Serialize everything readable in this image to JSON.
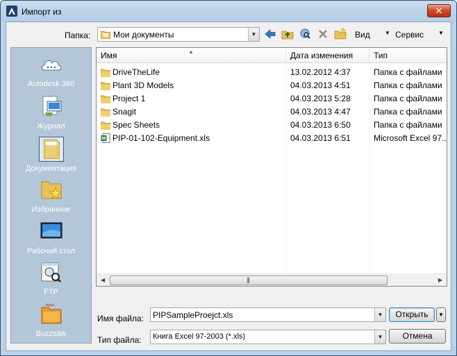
{
  "window": {
    "title": "Импорт из",
    "close_glyph": "✕"
  },
  "toolbar": {
    "folder_label": "Папка:",
    "folder_value": "Мои документы",
    "buttons": [
      "back-icon",
      "up-folder-icon",
      "search-web-icon",
      "delete-icon",
      "new-folder-icon"
    ],
    "view_label": "Вид",
    "service_label": "Сервис"
  },
  "places": [
    {
      "label": "Autodesk 360",
      "icon": "cloud-icon"
    },
    {
      "label": "Журнал",
      "icon": "history-icon"
    },
    {
      "label": "Документация",
      "icon": "documents-folder-icon"
    },
    {
      "label": "Избранное",
      "icon": "favorites-icon"
    },
    {
      "label": "Рабочий стол",
      "icon": "desktop-icon"
    },
    {
      "label": "FTP",
      "icon": "ftp-icon"
    },
    {
      "label": "Buzzsaw",
      "icon": "buzzsaw-icon"
    }
  ],
  "filelist": {
    "columns": [
      "Имя",
      "Дата изменения",
      "Тип"
    ],
    "rows": [
      {
        "name": "DriveTheLife",
        "date": "13.02.2012 4:37",
        "type": "Папка с файлами",
        "icon": "folder-icon"
      },
      {
        "name": "Plant 3D Models",
        "date": "04.03.2013 4:51",
        "type": "Папка с файлами",
        "icon": "folder-icon"
      },
      {
        "name": "Project 1",
        "date": "04.03.2013 5:28",
        "type": "Папка с файлами",
        "icon": "folder-icon"
      },
      {
        "name": "Snagit",
        "date": "04.03.2013 4:47",
        "type": "Папка с файлами",
        "icon": "folder-icon"
      },
      {
        "name": "Spec Sheets",
        "date": "04.03.2013 6:50",
        "type": "Папка с файлами",
        "icon": "folder-icon"
      },
      {
        "name": "PIP-01-102-Equipment.xls",
        "date": "04.03.2013 6:51",
        "type": "Microsoft Excel 97...",
        "icon": "excel-file-icon"
      }
    ]
  },
  "bottom": {
    "filename_label": "Имя файла:",
    "filename_value": "PIPSampleProejct.xls",
    "filetype_label": "Тип файла:",
    "filetype_value": "Книга Excel 97-2003 (*.xls)",
    "open_label": "Открыть",
    "cancel_label": "Отмена"
  },
  "colors": {
    "frame": "#b9d1ea",
    "places_bg": "#b4c7d9",
    "folder_yellow": "#e8c15a",
    "excel_green": "#1f7a3a"
  }
}
